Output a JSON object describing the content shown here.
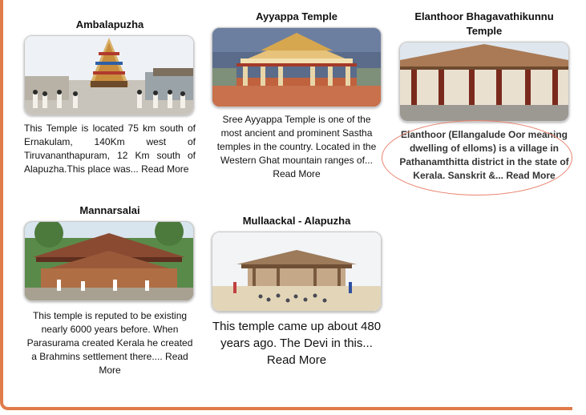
{
  "cards": [
    {
      "title": "Ambalapuzha",
      "description": "This Temple is located 75 km south of Ernakulam, 140Km west of Tiruvananthapuram, 12 Km south of Alapuzha.This place was...",
      "read_more": "Read More"
    },
    {
      "title": "Ayyappa Temple",
      "description": "Sree Ayyappa Temple is one of the most ancient and prominent Sastha temples in the country. Located in the Western Ghat mountain ranges of...",
      "read_more": "Read More"
    },
    {
      "title": "Elanthoor Bhagavathikunnu Temple",
      "description": "Elanthoor (Ellangalude Oor meaning dwelling of elloms) is a village in Pathanamthitta district in the state of Kerala. Sanskrit &...",
      "read_more": "Read More"
    },
    {
      "title": "Mannarsalai",
      "description": "This  temple is reputed to be existing nearly 6000 years before. When Parasurama created Kerala he created a Brahmins  settlement  there....",
      "read_more": "Read More"
    },
    {
      "title": "Mullaackal - Alapuzha",
      "description": "This  temple came up about 480 years ago. The Devi  in this...",
      "read_more": "Read More"
    }
  ],
  "colors": {
    "frame_border": "#e07b4a",
    "highlight": "#e8826e"
  }
}
